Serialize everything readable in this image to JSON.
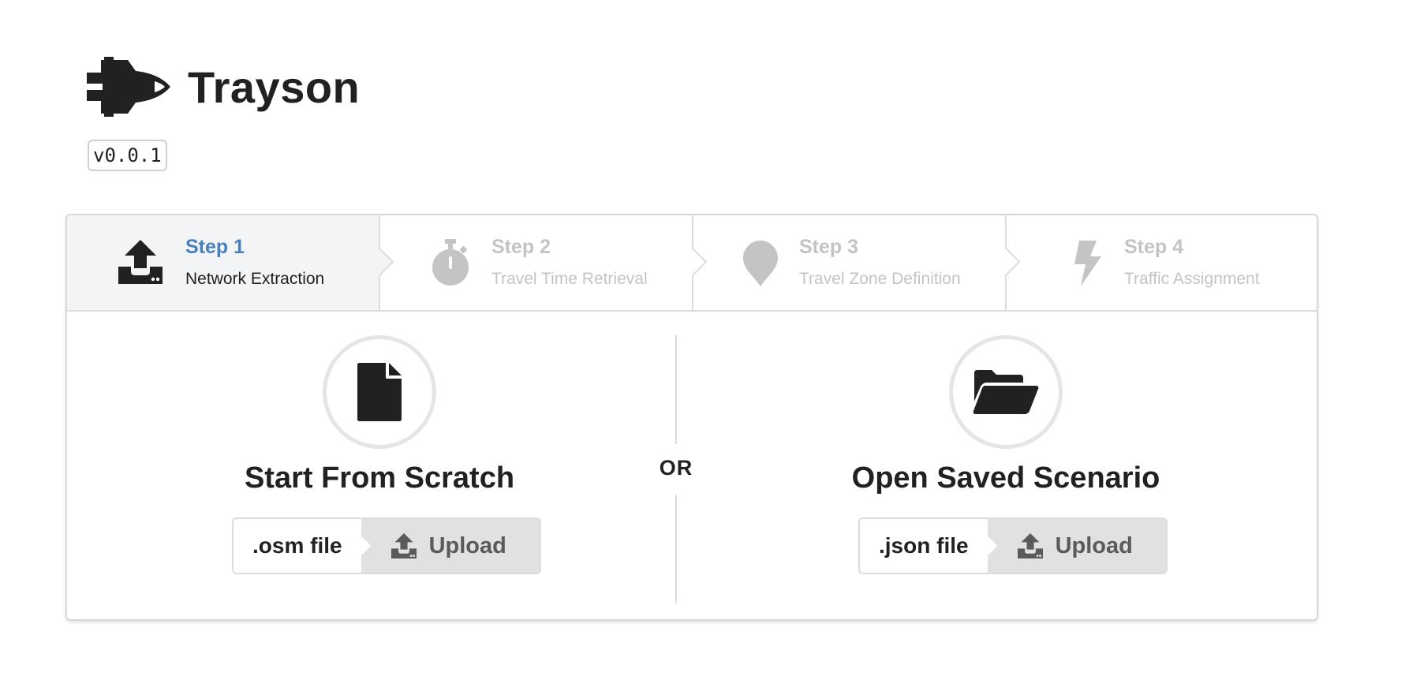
{
  "app": {
    "title": "Trayson",
    "version": "v0.0.1",
    "logo_icon": "space-shuttle-icon"
  },
  "steps": [
    {
      "title": "Step 1",
      "description": "Network Extraction",
      "icon": "upload-icon",
      "active": true
    },
    {
      "title": "Step 2",
      "description": "Travel Time Retrieval",
      "icon": "stopwatch-icon",
      "active": false
    },
    {
      "title": "Step 3",
      "description": "Travel Zone Definition",
      "icon": "map-marker-icon",
      "active": false
    },
    {
      "title": "Step 4",
      "description": "Traffic Assignment",
      "icon": "lightning-icon",
      "active": false
    }
  ],
  "start_scratch": {
    "title": "Start From Scratch",
    "icon": "file-icon",
    "file_label": ".osm file",
    "button_label": "Upload"
  },
  "divider": {
    "label": "OR"
  },
  "open_saved": {
    "title": "Open Saved Scenario",
    "icon": "folder-open-icon",
    "file_label": ".json file",
    "button_label": "Upload"
  },
  "colors": {
    "active_step": "#4a7fbd",
    "inactive_step": "#c4c4c4",
    "text": "#212121",
    "button_bg": "#e0e1e2",
    "button_text": "#5a5a5a"
  }
}
